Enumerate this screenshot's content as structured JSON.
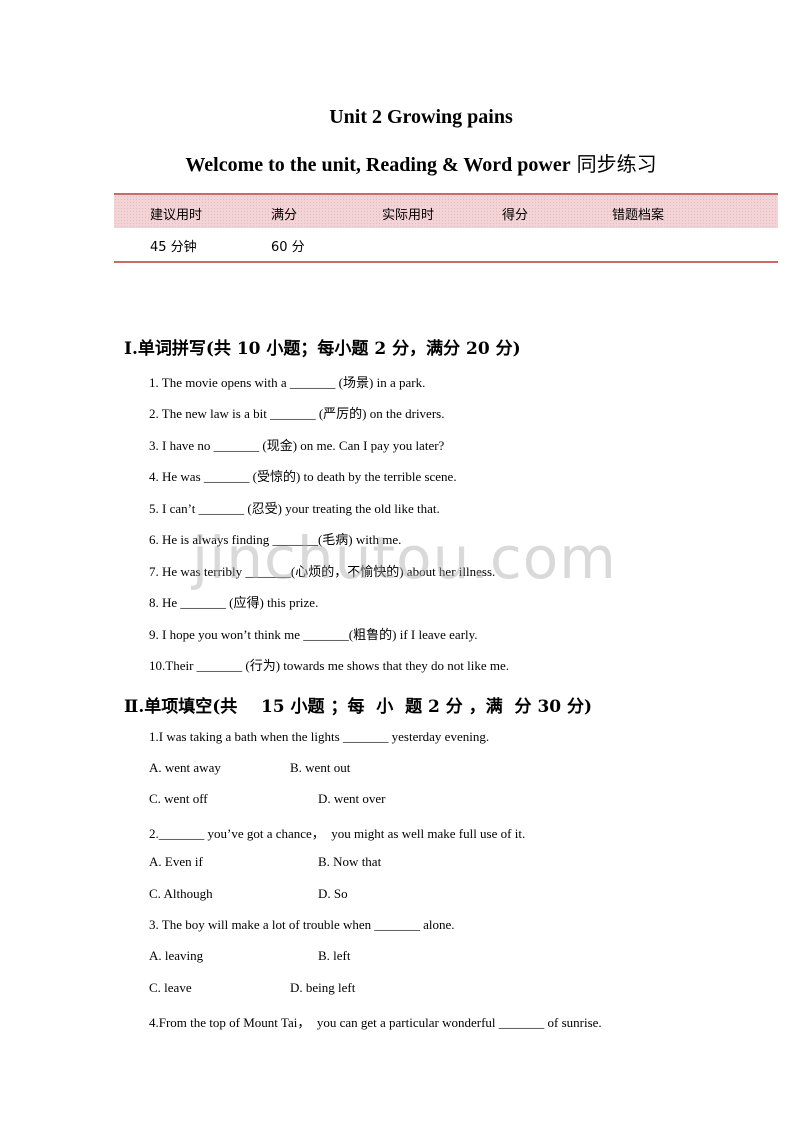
{
  "title": {
    "line1": "Unit 2 Growing pains",
    "line2_en": "Welcome to the unit, Reading & Word power",
    "line2_cn": "同步练习"
  },
  "info_table": {
    "headers": [
      "建议用时",
      "满分",
      "实际用时",
      "得分",
      "错题档案"
    ],
    "values": [
      "45 分钟",
      "60 分",
      "",
      "",
      ""
    ],
    "accent_color": "#c96b6b",
    "header_bg": "#f2d3d6"
  },
  "section1": {
    "heading": "Ⅰ.单词拼写(共 10 小题；每小题 2 分，满分 20 分)",
    "items": [
      "1. The movie opens with a _______ (场景) in a park.",
      "2. The new law is a bit _______ (严厉的) on the drivers.",
      "3. I have no _______ (现金) on me. Can I pay you later?",
      "4. He was _______ (受惊的) to death by the terrible scene.",
      "5. I can’t _______ (忍受) your treating the old like that.",
      "6. He is always finding _______(毛病) with me.",
      "7. He was terribly _______(心烦的，不愉快的) about her illness.",
      "8. He _______ (应得) this prize.",
      "9. I hope you won’t think me _______(粗鲁的) if I leave early.",
      "10.Their _______ (行为) towards me shows that they do not like me."
    ]
  },
  "section2": {
    "heading": "Ⅱ.单项填空(共    15 小题 ；每  小  题 2 分 ，满  分 30 分)",
    "questions": [
      {
        "stem": "1.I was taking a bath when the lights _______ yesterday evening.",
        "options": [
          "A. went away",
          "B. went out",
          "C. went off",
          "D. went over"
        ]
      },
      {
        "stem": "2._______ you’ve got a chance，  you might as well make full use of it.",
        "options": [
          "A. Even if",
          "B. Now that",
          "C. Although",
          "D. So"
        ]
      },
      {
        "stem": "3. The boy will make a lot of trouble when _______ alone.",
        "options": [
          "A. leaving",
          "B. left",
          "C. leave",
          "D. being left"
        ]
      },
      {
        "stem": "4.From the top of Mount Tai，  you can get a particular wonderful _______ of sunrise.",
        "options": []
      }
    ]
  },
  "watermark": "jinchutou.com"
}
